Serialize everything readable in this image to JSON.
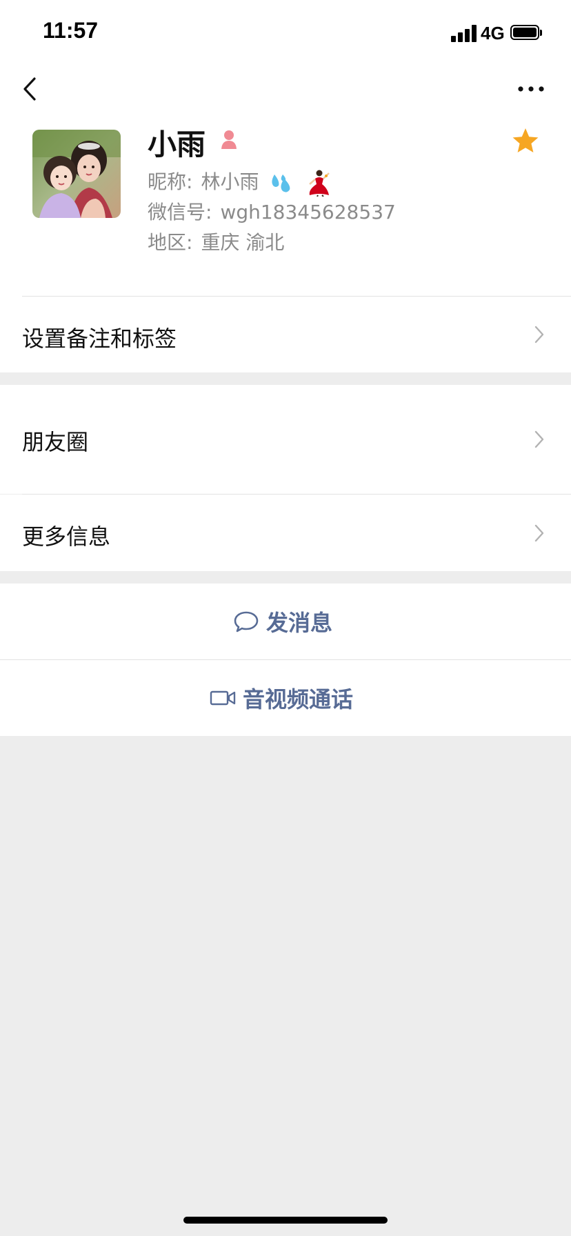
{
  "status_bar": {
    "time": "11:57",
    "network": "4G"
  },
  "profile": {
    "name": "小雨",
    "nickname_label": "昵称:",
    "nickname": "林小雨",
    "wechat_id_label": "微信号:",
    "wechat_id": "wgh18345628537",
    "region_label": "地区:",
    "region": "重庆 渝北"
  },
  "menu": {
    "remark_tags": "设置备注和标签",
    "moments": "朋友圈",
    "more_info": "更多信息"
  },
  "actions": {
    "send_message": "发消息",
    "video_call": "音视频通话"
  },
  "colors": {
    "link_blue": "#576b95",
    "star_orange": "#f6a623",
    "background_gray": "#ededed",
    "secondary_text": "#8a8a8a"
  },
  "icons": [
    "back-icon",
    "more-icon",
    "gender-female-icon",
    "star-icon",
    "chevron-right-icon",
    "chat-bubble-icon",
    "video-camera-icon"
  ]
}
